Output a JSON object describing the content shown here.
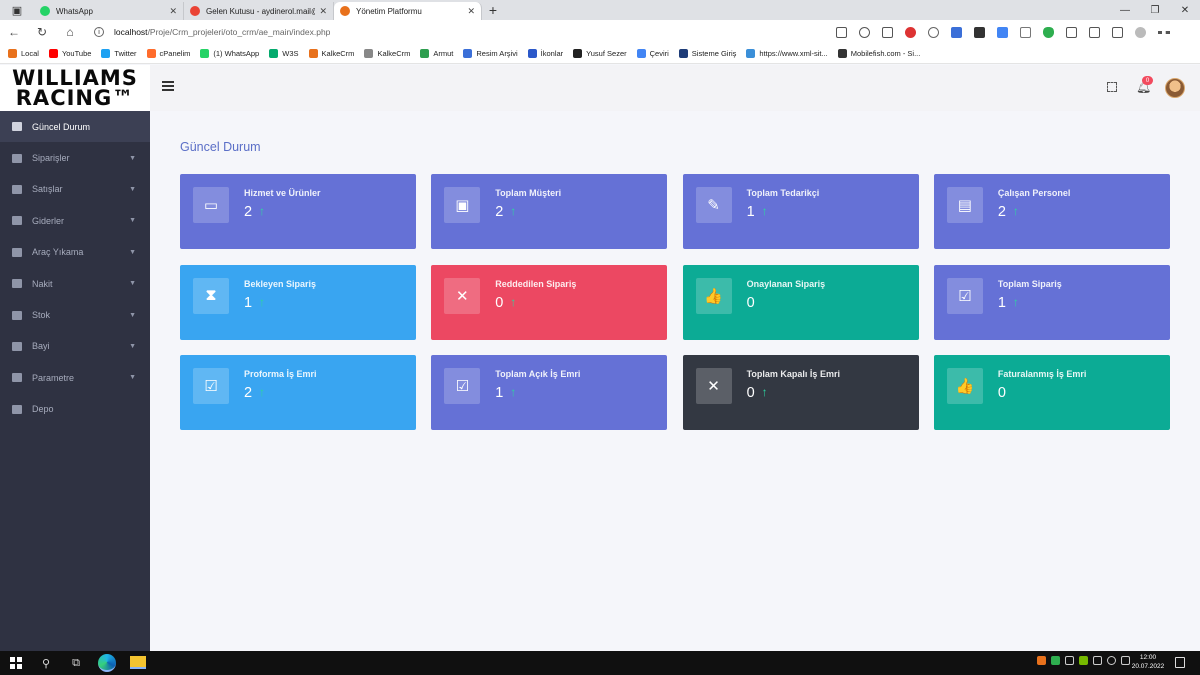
{
  "browser": {
    "tabs": [
      {
        "title": "WhatsApp",
        "color": "#25d366"
      },
      {
        "title": "Gelen Kutusu - aydinerol.mail@",
        "color": "#ea4335"
      },
      {
        "title": "Yönetim Platformu",
        "color": "#e8711c"
      }
    ],
    "url_host": "localhost",
    "url_path": "/Proje/Crm_projeleri/oto_crm/ae_main/index.php",
    "bookmarks": [
      {
        "label": "Local",
        "color": "#e8711c"
      },
      {
        "label": "YouTube",
        "color": "#ff0000"
      },
      {
        "label": "Twitter",
        "color": "#1da1f2"
      },
      {
        "label": "cPanelim",
        "color": "#ff6c2c"
      },
      {
        "label": "(1) WhatsApp",
        "color": "#25d366"
      },
      {
        "label": "W3S",
        "color": "#04aa6d"
      },
      {
        "label": "KalkeCrm",
        "color": "#e8711c"
      },
      {
        "label": "KalkeCrm",
        "color": "#888888"
      },
      {
        "label": "Armut",
        "color": "#2e9e4f"
      },
      {
        "label": "Resim Arşivi",
        "color": "#3b6fd8"
      },
      {
        "label": "İkonlar",
        "color": "#2b58c9"
      },
      {
        "label": "Yusuf Sezer",
        "color": "#222222"
      },
      {
        "label": "Çeviri",
        "color": "#4285f4"
      },
      {
        "label": "Sisteme Giriş",
        "color": "#1e3c78"
      },
      {
        "label": "https://www.xml-sit...",
        "color": "#3b8fd8"
      },
      {
        "label": "Mobilefish.com - Si...",
        "color": "#333333"
      }
    ]
  },
  "logo": {
    "line1": "WILLIAMS",
    "line2": "RACING™"
  },
  "topbar": {
    "notification_count": "0"
  },
  "sidebar": {
    "items": [
      {
        "label": "Güncel Durum",
        "has_children": false
      },
      {
        "label": "Siparişler",
        "has_children": true
      },
      {
        "label": "Satışlar",
        "has_children": true
      },
      {
        "label": "Giderler",
        "has_children": true
      },
      {
        "label": "Araç Yıkama",
        "has_children": true
      },
      {
        "label": "Nakit",
        "has_children": true
      },
      {
        "label": "Stok",
        "has_children": true
      },
      {
        "label": "Bayi",
        "has_children": true
      },
      {
        "label": "Parametre",
        "has_children": true
      },
      {
        "label": "Depo",
        "has_children": false
      }
    ]
  },
  "page": {
    "title": "Güncel Durum"
  },
  "cards": [
    {
      "title": "Hizmet ve Ürünler",
      "value": "2",
      "trend_up": true,
      "color": "indigo",
      "icon": "briefcase-icon",
      "glyph": "▭"
    },
    {
      "title": "Toplam Müşteri",
      "value": "2",
      "trend_up": true,
      "color": "indigo",
      "icon": "sticky-notes-icon",
      "glyph": "▣"
    },
    {
      "title": "Toplam Tedarikçi",
      "value": "1",
      "trend_up": true,
      "color": "indigo",
      "icon": "pen-icon",
      "glyph": "✎"
    },
    {
      "title": "Çalışan Personel",
      "value": "2",
      "trend_up": true,
      "color": "indigo",
      "icon": "document-clock-icon",
      "glyph": "▤"
    },
    {
      "title": "Bekleyen Sipariş",
      "value": "1",
      "trend_up": true,
      "color": "blue",
      "icon": "hourglass-icon",
      "glyph": "⧗"
    },
    {
      "title": "Reddedilen Sipariş",
      "value": "0",
      "trend_up": true,
      "color": "red",
      "icon": "close-icon",
      "glyph": "✕"
    },
    {
      "title": "Onaylanan Sipariş",
      "value": "0",
      "trend_up": false,
      "color": "teal",
      "icon": "thumbs-up-icon",
      "glyph": "👍"
    },
    {
      "title": "Toplam Sipariş",
      "value": "1",
      "trend_up": true,
      "color": "indigo",
      "icon": "check-square-icon",
      "glyph": "☑"
    },
    {
      "title": "Proforma İş Emri",
      "value": "2",
      "trend_up": true,
      "color": "blue",
      "icon": "check-square-icon",
      "glyph": "☑"
    },
    {
      "title": "Toplam Açık İş Emri",
      "value": "1",
      "trend_up": true,
      "color": "indigo",
      "icon": "check-square-icon",
      "glyph": "☑"
    },
    {
      "title": "Toplam Kapalı İş Emri",
      "value": "0",
      "trend_up": true,
      "color": "dark",
      "icon": "close-icon",
      "glyph": "✕"
    },
    {
      "title": "Faturalanmış İş Emri",
      "value": "0",
      "trend_up": false,
      "color": "teal",
      "icon": "thumbs-up-icon",
      "glyph": "👍"
    }
  ],
  "taskbar": {
    "time": "12:00",
    "date": "20.07.2022"
  }
}
